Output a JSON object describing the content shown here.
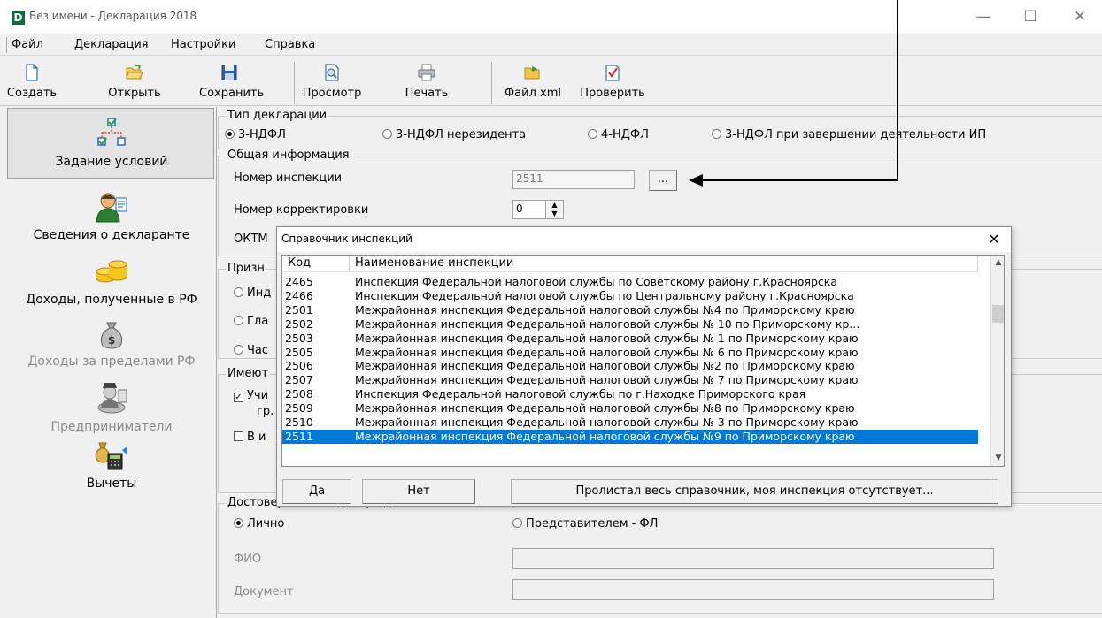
{
  "window": {
    "title": "Без имени - Декларация 2018",
    "logo_letter": "D",
    "minimize_glyph": "—",
    "maximize_glyph": "☐",
    "close_glyph": "✕"
  },
  "menu": [
    "Файл",
    "Декларация",
    "Настройки",
    "Справка"
  ],
  "toolbar": [
    {
      "label": "Создать",
      "icon": "new-file-icon"
    },
    {
      "label": "Открыть",
      "icon": "open-folder-icon"
    },
    {
      "label": "Сохранить",
      "icon": "save-disk-icon"
    },
    {
      "label": "Просмотр",
      "icon": "preview-icon"
    },
    {
      "label": "Печать",
      "icon": "printer-icon"
    },
    {
      "label": "Файл xml",
      "icon": "xml-file-icon"
    },
    {
      "label": "Проверить",
      "icon": "check-icon"
    }
  ],
  "nav": [
    {
      "label": "Задание условий",
      "icon": "conditions-icon",
      "active": true
    },
    {
      "label": "Сведения о декларанте",
      "icon": "person-icon"
    },
    {
      "label": "Доходы, полученные в РФ",
      "icon": "coins-icon"
    },
    {
      "label": "Доходы за пределами РФ",
      "icon": "money-bag-icon",
      "disabled": true
    },
    {
      "label": "Предприниматели",
      "icon": "businessman-icon",
      "disabled": true
    },
    {
      "label": "Вычеты",
      "icon": "deductions-icon"
    }
  ],
  "form": {
    "decl_type": {
      "title": "Тип декларации",
      "options": [
        "3-НДФЛ",
        "3-НДФЛ нерезидента",
        "4-НДФЛ",
        "3-НДФЛ при завершении деятельности ИП"
      ],
      "selected": "3-НДФЛ"
    },
    "general": {
      "title": "Общая информация",
      "inspection_label": "Номер инспекции",
      "inspection_value": "2511",
      "browse_label": "...",
      "correction_label": "Номер корректировки",
      "correction_value": "0",
      "oktmo_label": "ОКТМ"
    },
    "sign": {
      "title": "Призн",
      "options": [
        "Инд",
        "Гла",
        "Час"
      ]
    },
    "have": {
      "title": "Имеют",
      "check1": "Учи",
      "check1_tail": "гр.",
      "check2": "В и"
    },
    "reliability": {
      "title_visible": "Досто",
      "title_cut": "верность подтверждается",
      "personal": "Лично",
      "representative": "Представителем - ФЛ",
      "fio_label": "ФИО",
      "doc_label": "Документ"
    }
  },
  "dialog": {
    "title": "Справочник инспекций",
    "close_glyph": "✕",
    "columns": [
      "Код",
      "Наименование инспекции"
    ],
    "rows": [
      {
        "code": "2465",
        "name": "Инспекция Федеральной налоговой службы по Советскому району г.Красноярска"
      },
      {
        "code": "2466",
        "name": "Инспекция Федеральной налоговой службы по Центральному району г.Красноярска"
      },
      {
        "code": "2501",
        "name": "Межрайонная инспекция Федеральной налоговой службы №4 по Приморскому краю"
      },
      {
        "code": "2502",
        "name": "Межрайонная инспекция Федеральной налоговой службы № 10 по Приморскому кр..."
      },
      {
        "code": "2503",
        "name": "Межрайонная инспекция Федеральной налоговой службы № 1 по Приморскому краю"
      },
      {
        "code": "2505",
        "name": "Межрайонная инспекция Федеральной налоговой службы № 6 по Приморскому краю"
      },
      {
        "code": "2506",
        "name": "Межрайонная инспекция Федеральной налоговой службы №2 по Приморскому краю"
      },
      {
        "code": "2507",
        "name": "Межрайонная инспекция Федеральной налоговой службы № 7 по Приморскому краю"
      },
      {
        "code": "2508",
        "name": "Инспекция Федеральной налоговой службы по г.Находке Приморского края"
      },
      {
        "code": "2509",
        "name": "Межрайонная инспекция Федеральной налоговой службы №8 по Приморскому краю"
      },
      {
        "code": "2510",
        "name": "Межрайонная инспекция Федеральной налоговой службы № 3 по Приморскому краю"
      },
      {
        "code": "2511",
        "name": "Межрайонная инспекция Федеральной налоговой службы №9 по Приморскому краю",
        "selected": true
      }
    ],
    "buttons": {
      "yes": "Да",
      "no": "Нет",
      "missing": "Пролистал весь справочник, моя инспекция отсутствует..."
    }
  },
  "colors": {
    "selection": "#0078d7",
    "window_bg": "#f0f0f0",
    "annotation": "#000000"
  }
}
